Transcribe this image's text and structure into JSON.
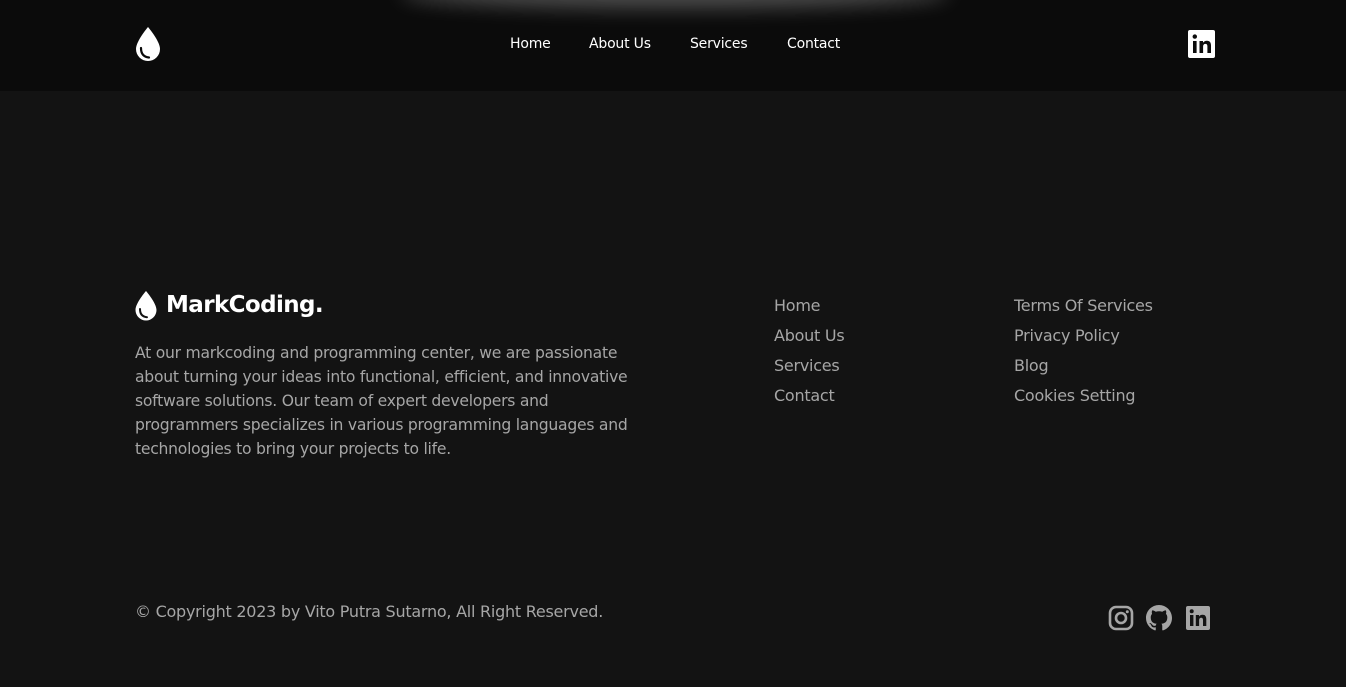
{
  "nav": {
    "logo_icon": "drop-icon",
    "links": [
      "Home",
      "About Us",
      "Services",
      "Contact"
    ],
    "social_icon": "linkedin-icon"
  },
  "footer": {
    "brand": {
      "logo_icon": "drop-icon",
      "name": "MarkCoding."
    },
    "description": "At our markcoding and programming center, we are passionate about turning your ideas into functional, efficient, and innovative software solutions. Our team of expert developers and programmers specializes in various programming languages and technologies to bring your projects to life.",
    "links_primary": [
      "Home",
      "About Us",
      "Services",
      "Contact"
    ],
    "links_secondary": [
      "Terms Of Services",
      "Privacy Policy",
      "Blog",
      "Cookies Setting"
    ],
    "copyright": "© Copyright 2023 by Vito Putra Sutarno, All Right Reserved.",
    "social_icons": [
      "instagram-icon",
      "github-icon",
      "linkedin-icon"
    ]
  },
  "colors": {
    "background": "#131313",
    "navbar": "#0b0b0b",
    "text_primary": "#ffffff",
    "text_muted": "#a6a6a6"
  }
}
